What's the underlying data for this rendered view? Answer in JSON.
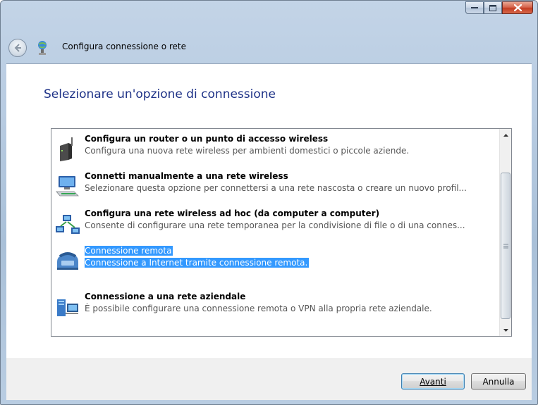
{
  "window": {
    "title": "Configura connessione o rete",
    "caption_buttons": [
      "minimize",
      "maximize",
      "close"
    ]
  },
  "page": {
    "heading": "Selezionare un'opzione di connessione"
  },
  "options": [
    {
      "icon": "wireless-router-icon",
      "title": "Configura un router o un punto di accesso wireless",
      "desc": "Configura una nuova rete wireless per ambienti domestici o piccole aziende.",
      "selected": false
    },
    {
      "icon": "manual-wireless-icon",
      "title": "Connetti manualmente a una rete wireless",
      "desc": "Selezionare questa opzione per connettersi a una rete nascosta o creare un nuovo profil...",
      "selected": false
    },
    {
      "icon": "adhoc-network-icon",
      "title": "Configura una rete wireless ad hoc (da computer a computer)",
      "desc": "Consente di configurare una rete temporanea per la condivisione di file o di una connes...",
      "selected": false
    },
    {
      "icon": "dialup-modem-icon",
      "title": "Connessione remota",
      "desc": "Connessione a Internet tramite connessione remota.",
      "selected": true
    },
    {
      "icon": "workplace-network-icon",
      "title": "Connessione a una rete aziendale",
      "desc": "È possibile configurare una connessione remota o VPN alla propria rete aziendale.",
      "selected": false
    }
  ],
  "buttons": {
    "next": "Avanti",
    "cancel": "Annulla"
  }
}
